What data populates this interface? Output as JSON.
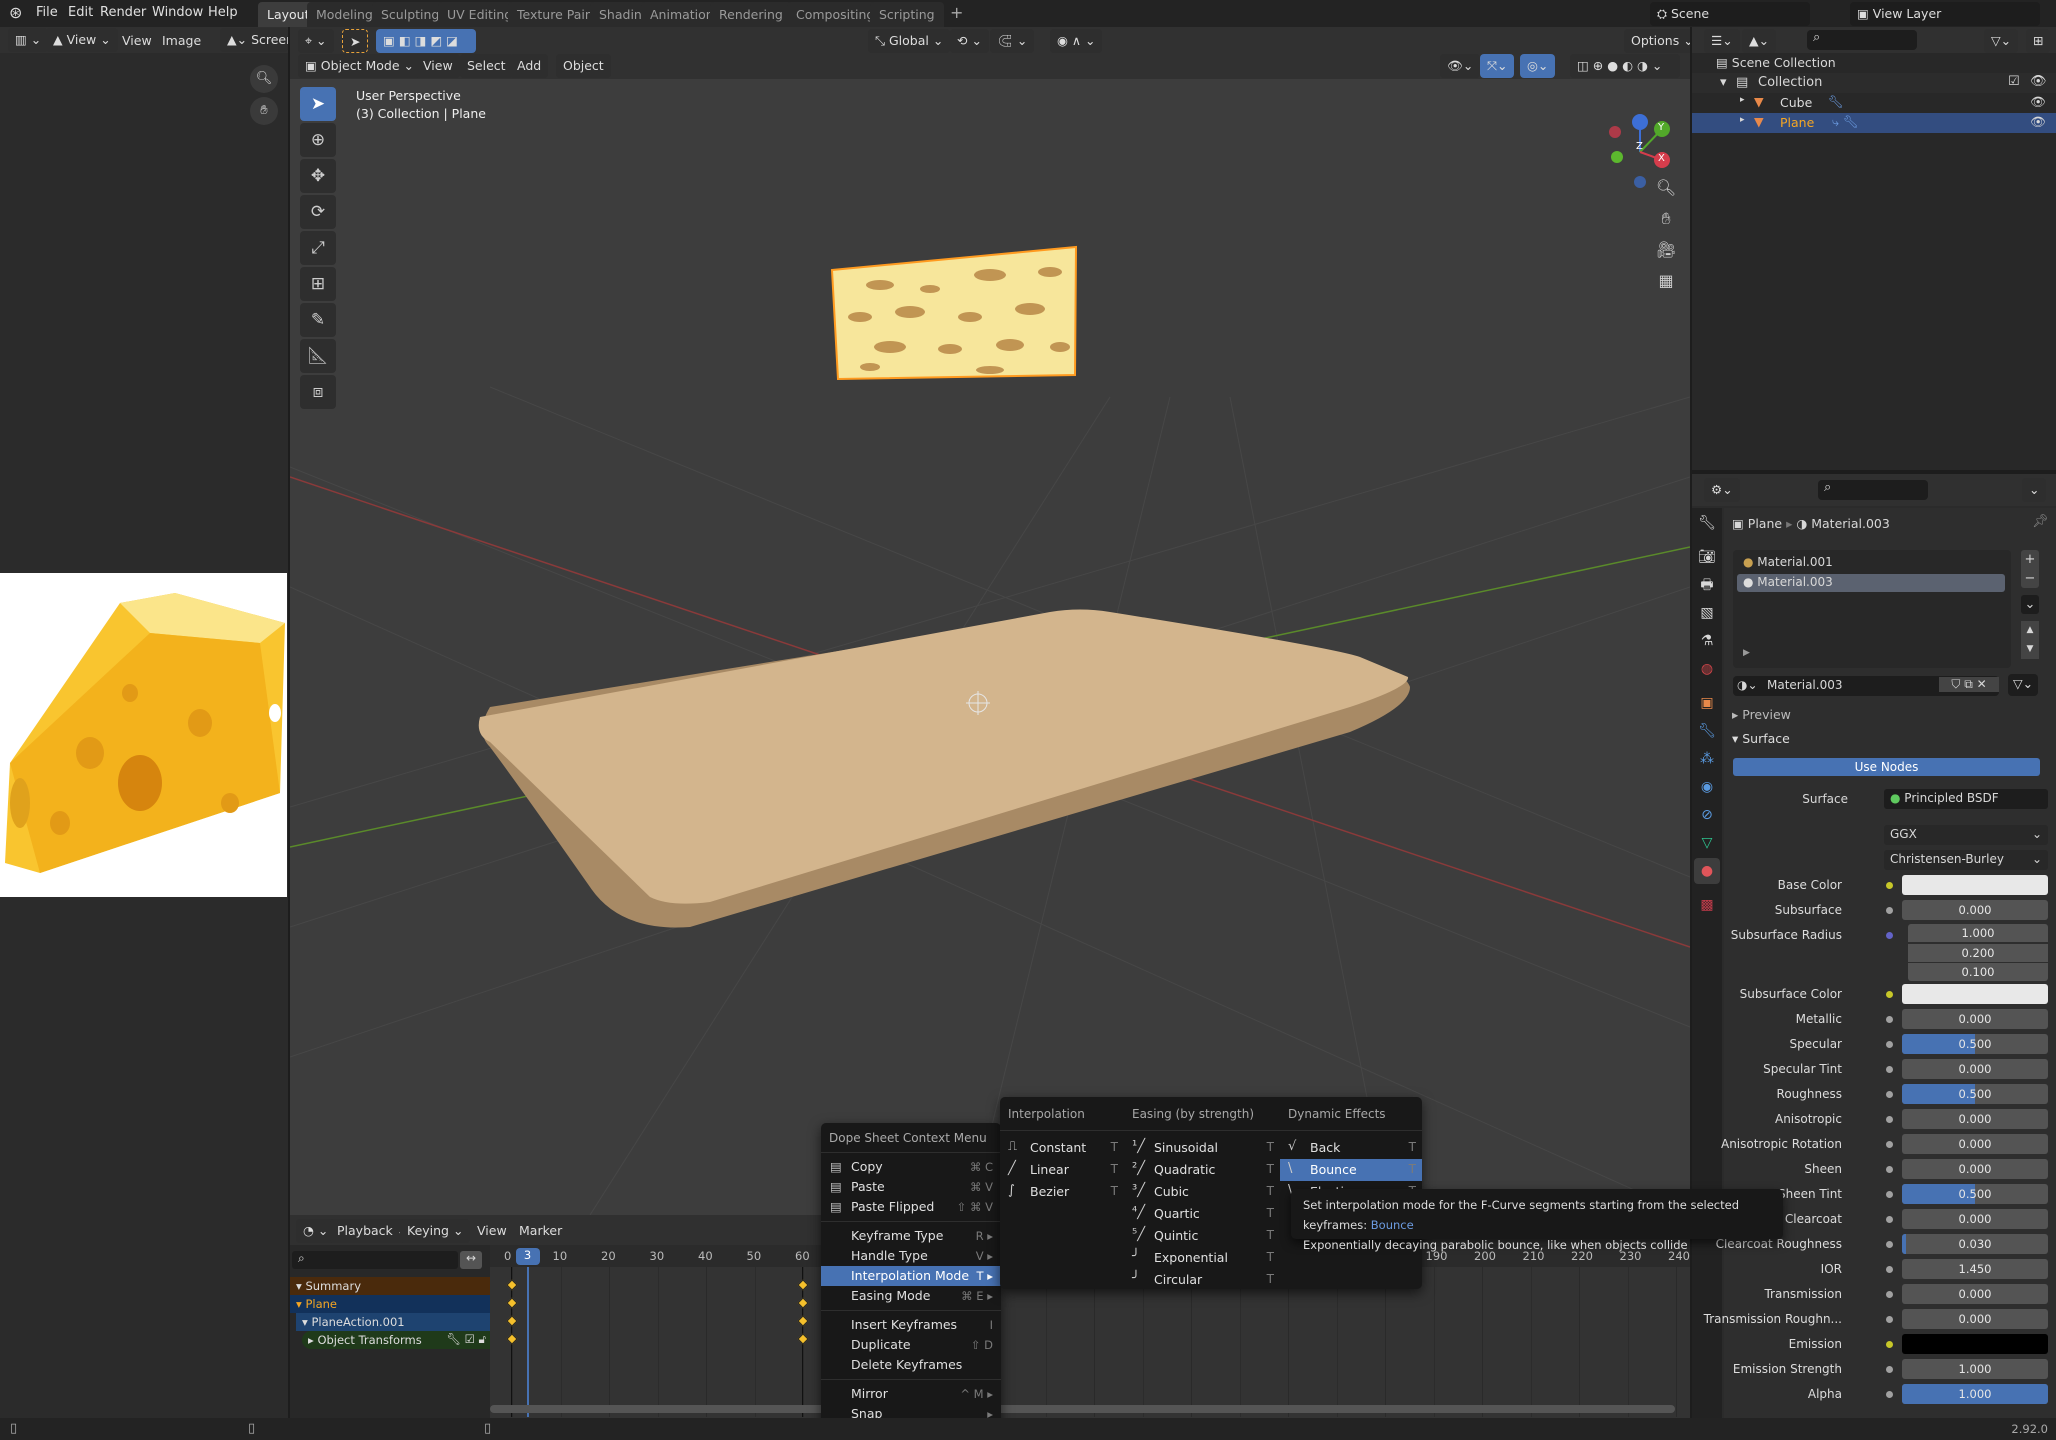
{
  "topbar": {
    "menus": [
      "File",
      "Edit",
      "Render",
      "Window",
      "Help"
    ],
    "workspaces": [
      "Layout",
      "Modeling",
      "Sculpting",
      "UV Editing",
      "Texture Paint",
      "Shading",
      "Animation",
      "Rendering",
      "Compositing",
      "Scripting"
    ],
    "active_workspace": "Layout",
    "scene": "Scene",
    "view_layer": "View Layer"
  },
  "image_editor": {
    "view": "View",
    "view2": "View",
    "image": "Image",
    "screen": "Screen"
  },
  "viewport": {
    "transform_orientation": "Global",
    "options": "Options",
    "mode": "Object Mode",
    "menus": [
      "View",
      "Select",
      "Add",
      "Object"
    ],
    "info_line1": "User Perspective",
    "info_line2": "(3) Collection | Plane",
    "gizmo": {
      "x": "X",
      "y": "Y",
      "z": "Z"
    }
  },
  "timeline": {
    "menus": [
      "Playback",
      "Keying",
      "View",
      "Marker"
    ],
    "current_frame": 3,
    "frame_labels": [
      0,
      10,
      20,
      30,
      40,
      50,
      60,
      190,
      200,
      210,
      220,
      230,
      240
    ],
    "keyframes": [
      0,
      60
    ],
    "channels": [
      {
        "label": "Summary",
        "kind": "summary"
      },
      {
        "label": "Plane",
        "kind": "object"
      },
      {
        "label": "PlaneAction.001",
        "kind": "action"
      },
      {
        "label": "Object Transforms",
        "kind": "group"
      }
    ]
  },
  "context_menu": {
    "title": "Dope Sheet Context Menu",
    "groups": [
      [
        {
          "label": "Copy",
          "shortcut": "⌘ C",
          "icon": "copy-icon"
        },
        {
          "label": "Paste",
          "shortcut": "⌘ V",
          "icon": "paste-icon"
        },
        {
          "label": "Paste Flipped",
          "shortcut": "⇧ ⌘ V",
          "icon": "paste-flipped-icon"
        }
      ],
      [
        {
          "label": "Keyframe Type",
          "shortcut": "R ▸"
        },
        {
          "label": "Handle Type",
          "shortcut": "V ▸"
        },
        {
          "label": "Interpolation Mode",
          "shortcut": "T ▸",
          "highlighted": true
        },
        {
          "label": "Easing Mode",
          "shortcut": "⌘ E ▸"
        }
      ],
      [
        {
          "label": "Insert Keyframes",
          "shortcut": "I"
        },
        {
          "label": "Duplicate",
          "shortcut": "⇧ D"
        },
        {
          "label": "Delete Keyframes",
          "shortcut": ""
        }
      ],
      [
        {
          "label": "Mirror",
          "shortcut": "^ M ▸"
        },
        {
          "label": "Snap",
          "shortcut": "▸"
        }
      ]
    ]
  },
  "interpolation_submenu": {
    "columns": [
      {
        "header": "Interpolation",
        "items": [
          {
            "label": "Constant",
            "shortcut": "T",
            "icon": "⎍"
          },
          {
            "label": "Linear",
            "shortcut": "T",
            "icon": "╱"
          },
          {
            "label": "Bezier",
            "shortcut": "T",
            "icon": "∫"
          }
        ]
      },
      {
        "header": "Easing (by strength)",
        "items": [
          {
            "label": "Sinusoidal",
            "shortcut": "T",
            "icon": "¹╱"
          },
          {
            "label": "Quadratic",
            "shortcut": "T",
            "icon": "²╱"
          },
          {
            "label": "Cubic",
            "shortcut": "T",
            "icon": "³╱"
          },
          {
            "label": "Quartic",
            "shortcut": "T",
            "icon": "⁴╱"
          },
          {
            "label": "Quintic",
            "shortcut": "T",
            "icon": "⁵╱"
          },
          {
            "label": "Exponential",
            "shortcut": "T",
            "icon": "╯"
          },
          {
            "label": "Circular",
            "shortcut": "T",
            "icon": "╯"
          }
        ]
      },
      {
        "header": "Dynamic Effects",
        "items": [
          {
            "label": "Back",
            "shortcut": "T",
            "icon": "√"
          },
          {
            "label": "Bounce",
            "shortcut": "T",
            "icon": "\\",
            "highlighted": true
          },
          {
            "label": "Elastic",
            "shortcut": "T",
            "icon": "\\"
          }
        ]
      }
    ]
  },
  "tooltip": {
    "text": "Set interpolation mode for the F-Curve segments starting from the selected keyframes:",
    "value": "Bounce",
    "description": "Exponentially decaying parabolic bounce, like when objects collide"
  },
  "outliner": {
    "root": "Scene Collection",
    "collection": "Collection",
    "objects": [
      {
        "name": "Cube",
        "selected": false
      },
      {
        "name": "Plane",
        "selected": true
      }
    ]
  },
  "properties": {
    "breadcrumb_object": "Plane",
    "breadcrumb_material": "Material.003",
    "slots": [
      {
        "name": "Material.001",
        "selected": false
      },
      {
        "name": "Material.003",
        "selected": true
      }
    ],
    "material_name": "Material.003",
    "preview_label": "Preview",
    "surface_label": "Surface",
    "use_nodes": "Use Nodes",
    "surface_field_label": "Surface",
    "surface_shader": "Principled BSDF",
    "distribution": "GGX",
    "subsurface_method": "Christensen-Burley",
    "rows": [
      {
        "label": "Base Color",
        "type": "color",
        "color": "#e8e8e8",
        "socket": "#c7c729"
      },
      {
        "label": "Subsurface",
        "value": "0.000",
        "fill": 0
      },
      {
        "label": "Subsurface Radius",
        "type": "vector",
        "values": [
          "1.000",
          "0.200",
          "0.100"
        ],
        "socket": "#6363c7"
      },
      {
        "label": "Subsurface Color",
        "type": "color",
        "color": "#e8e8e8",
        "socket": "#c7c729"
      },
      {
        "label": "Metallic",
        "value": "0.000",
        "fill": 0
      },
      {
        "label": "Specular",
        "value": "0.500",
        "fill": 0.5
      },
      {
        "label": "Specular Tint",
        "value": "0.000",
        "fill": 0
      },
      {
        "label": "Roughness",
        "value": "0.500",
        "fill": 0.5
      },
      {
        "label": "Anisotropic",
        "value": "0.000",
        "fill": 0
      },
      {
        "label": "Anisotropic Rotation",
        "value": "0.000",
        "fill": 0
      },
      {
        "label": "Sheen",
        "value": "0.000",
        "fill": 0
      },
      {
        "label": "Sheen Tint",
        "value": "0.500",
        "fill": 0.5
      },
      {
        "label": "Clearcoat",
        "value": "0.000",
        "fill": 0
      },
      {
        "label": "Clearcoat Roughness",
        "value": "0.030",
        "fill": 0.03
      },
      {
        "label": "IOR",
        "value": "1.450",
        "fill": 0,
        "plain": true
      },
      {
        "label": "Transmission",
        "value": "0.000",
        "fill": 0
      },
      {
        "label": "Transmission Roughn...",
        "value": "0.000",
        "fill": 0
      },
      {
        "label": "Emission",
        "type": "color",
        "color": "#000000",
        "socket": "#c7c729"
      },
      {
        "label": "Emission Strength",
        "value": "1.000",
        "fill": 0,
        "plain": true
      },
      {
        "label": "Alpha",
        "value": "1.000",
        "fill": 1
      }
    ]
  },
  "statusbar": {
    "version": "2.92.0"
  },
  "colors": {
    "accent": "#4772b3",
    "selected_object": "#f5a623",
    "keyframe": "#f5c02c"
  }
}
